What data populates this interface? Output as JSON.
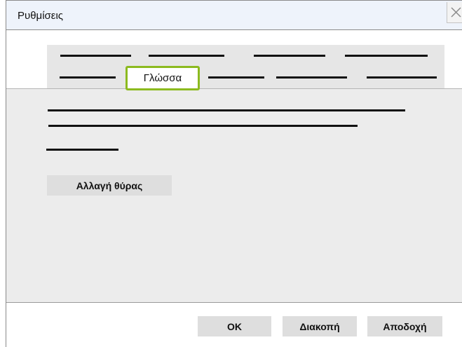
{
  "window": {
    "title": "Ρυθμίσεις"
  },
  "tabs": {
    "active_label": "Γλώσσα"
  },
  "content": {
    "change_port_label": "Αλλαγή θύρας"
  },
  "footer": {
    "ok_label": "OK",
    "cancel_label": "Διακοπή",
    "accept_label": "Αποδοχή"
  },
  "colors": {
    "active_tab_highlight": "#8cba1f",
    "content_background": "#ececec",
    "titlebar_background": "#eef3fb"
  }
}
